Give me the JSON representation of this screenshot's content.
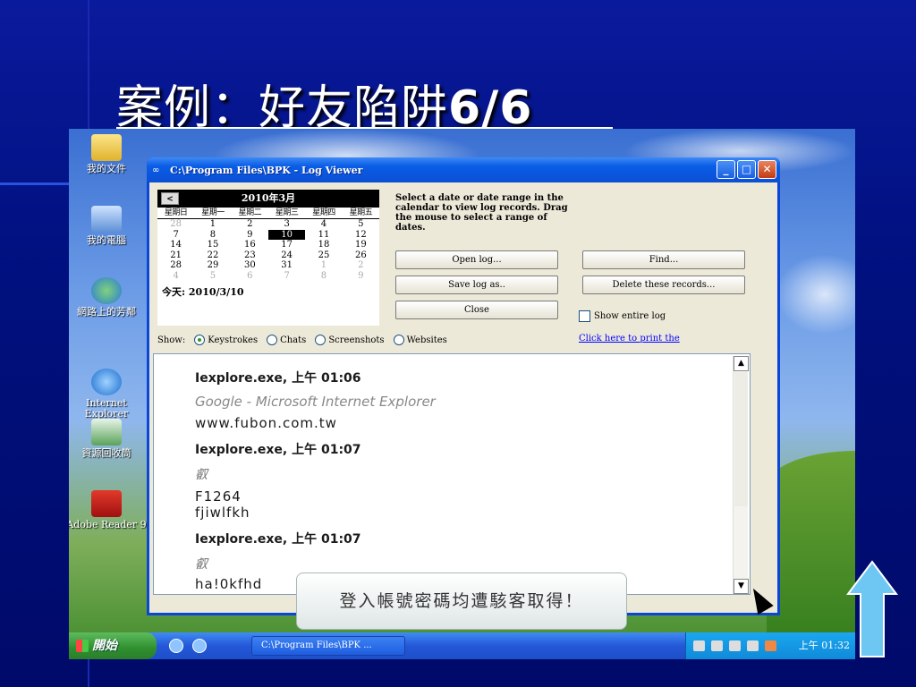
{
  "slide": {
    "title_cjk": "案例：好友陷阱",
    "title_num": "6/6"
  },
  "desktop": {
    "icons": [
      {
        "label": "我的文件"
      },
      {
        "label": "我的電腦"
      },
      {
        "label": "網路上的芳鄰"
      },
      {
        "label": "Internet Explorer"
      },
      {
        "label": "資源回收筒"
      },
      {
        "label": "Adobe Reader 9"
      }
    ]
  },
  "window": {
    "title": "C:\\Program Files\\BPK - Log Viewer",
    "controls": {
      "minimize": "_",
      "maximize": "□",
      "close": "✕"
    }
  },
  "calendar": {
    "prev": "<",
    "month_label": "2010年3月",
    "weekdays": [
      "星期日",
      "星期一",
      "星期二",
      "星期三",
      "星期四",
      "星期五"
    ],
    "weeks": [
      [
        "28",
        "1",
        "2",
        "3",
        "4",
        "5"
      ],
      [
        "7",
        "8",
        "9",
        "10",
        "11",
        "12"
      ],
      [
        "14",
        "15",
        "16",
        "17",
        "18",
        "19"
      ],
      [
        "21",
        "22",
        "23",
        "24",
        "25",
        "26"
      ],
      [
        "28",
        "29",
        "30",
        "31",
        "1",
        "2"
      ],
      [
        "4",
        "5",
        "6",
        "7",
        "8",
        "9"
      ]
    ],
    "selected": "10",
    "today_label": "今天: 2010/3/10"
  },
  "instructions": "Select a date or date range in the calendar to view log records. Drag the mouse to select a range of dates.",
  "buttons": {
    "open_log": "Open log...",
    "save_log_as": "Save log as..",
    "close": "Close",
    "find": "Find...",
    "delete_records": "Delete these records..."
  },
  "show_entire_log": "Show entire log",
  "print_link": "Click here to print the",
  "show": {
    "label": "Show:",
    "options": [
      "Keystrokes",
      "Chats",
      "Screenshots",
      "Websites"
    ],
    "selected": "Keystrokes"
  },
  "log": {
    "lines": [
      {
        "text": "Iexplore.exe, 上午 01:06",
        "style": "bold"
      },
      {
        "text": "Google - Microsoft Internet Explorer",
        "style": "italic"
      },
      {
        "text": "www.fubon.com.tw",
        "style": "plain"
      },
      {
        "text": "Iexplore.exe, 上午 01:07",
        "style": "bold"
      },
      {
        "text": "叡",
        "style": "cjk"
      },
      {
        "text": "F1264",
        "style": "plain"
      },
      {
        "text": "fjiwlfkh",
        "style": "plain"
      },
      {
        "text": "Iexplore.exe, 上午 01:07",
        "style": "bold"
      },
      {
        "text": "叡",
        "style": "cjk"
      },
      {
        "text": "ha!0kfhd",
        "style": "plain"
      }
    ]
  },
  "callout": "登入帳號密碼均遭駭客取得！",
  "taskbar": {
    "start": "開始",
    "task_label": "C:\\Program Files\\BPK ...",
    "clock": "上午 01:32"
  },
  "colors": {
    "slide_bg": "#00107e",
    "window_border": "#0a46d8",
    "arrow": "#6ec6f2"
  }
}
